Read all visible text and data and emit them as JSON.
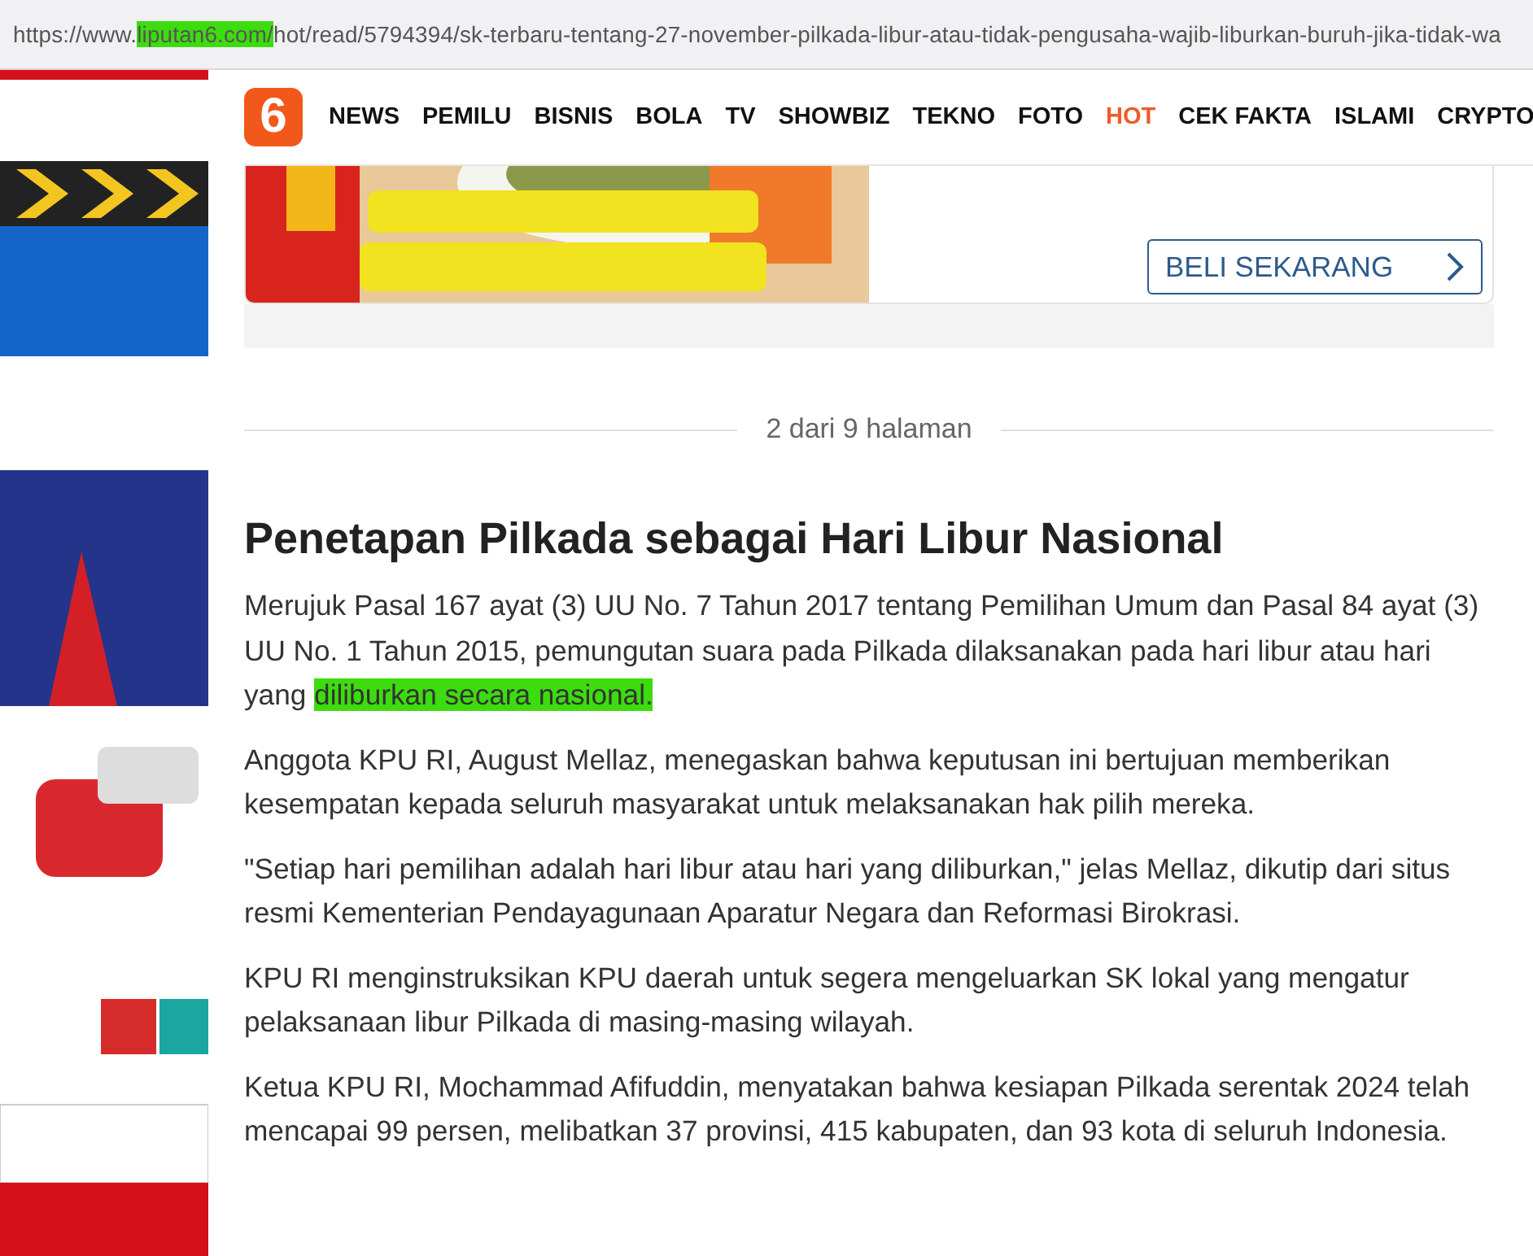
{
  "address_bar": {
    "url": [
      {
        "text": "https://www.",
        "highlighted": false
      },
      {
        "text": "liputan6.com/",
        "highlighted": true
      },
      {
        "text": "hot/read/5794394/sk-terbaru-tentang-27-november-pilkada-libur-atau-tidak-pengusaha-wajib-liburkan-buruh-jika-tidak-wa",
        "highlighted": false
      }
    ]
  },
  "nav": {
    "logo": "6",
    "items": [
      {
        "label": "NEWS",
        "selected": false
      },
      {
        "label": "PEMILU",
        "selected": false
      },
      {
        "label": "BISNIS",
        "selected": false
      },
      {
        "label": "BOLA",
        "selected": false
      },
      {
        "label": "TV",
        "selected": false
      },
      {
        "label": "SHOWBIZ",
        "selected": false
      },
      {
        "label": "TEKNO",
        "selected": false
      },
      {
        "label": "FOTO",
        "selected": false
      },
      {
        "label": "HOT",
        "selected": true
      },
      {
        "label": "CEK FAKTA",
        "selected": false
      },
      {
        "label": "ISLAMI",
        "selected": false
      },
      {
        "label": "CRYPTO",
        "selected": false
      }
    ]
  },
  "ad": {
    "button": "BELI SEKARANG"
  },
  "pagination": "2 dari 9 halaman",
  "article": {
    "heading": "Penetapan Pilkada sebagai Hari Libur Nasional",
    "paragraphs": [
      [
        {
          "text": "Merujuk Pasal 167 ayat (3) UU No. 7 Tahun 2017 tentang Pemilihan Umum dan Pasal 84 ayat (3) UU No. 1 Tahun 2015, pemungutan suara pada Pilkada dilaksanakan pada hari libur atau hari yang ",
          "highlighted": false
        },
        {
          "text": "diliburkan secara nasional.",
          "highlighted": true
        }
      ],
      [
        {
          "text": "Anggota KPU RI, August Mellaz, menegaskan bahwa keputusan ini bertujuan memberikan kesempatan kepada seluruh masyarakat untuk melaksanakan hak pilih mereka.",
          "highlighted": false
        }
      ],
      [
        {
          "text": "\"Setiap hari pemilihan adalah hari libur atau hari yang diliburkan,\" jelas Mellaz, dikutip dari situs resmi Kementerian Pendayagunaan Aparatur Negara dan Reformasi Birokrasi.",
          "highlighted": false
        }
      ],
      [
        {
          "text": "KPU RI menginstruksikan KPU daerah untuk segera mengeluarkan SK lokal yang mengatur pelaksanaan libur Pilkada di masing-masing wilayah.",
          "highlighted": false
        }
      ],
      [
        {
          "text": "Ketua KPU RI, Mochammad Afifuddin, menyatakan bahwa kesiapan Pilkada serentak 2024 telah mencapai 99 persen, melibatkan 37 provinsi, 415 kabupaten, dan 93 kota di seluruh Indonesia.",
          "highlighted": false
        }
      ]
    ]
  }
}
